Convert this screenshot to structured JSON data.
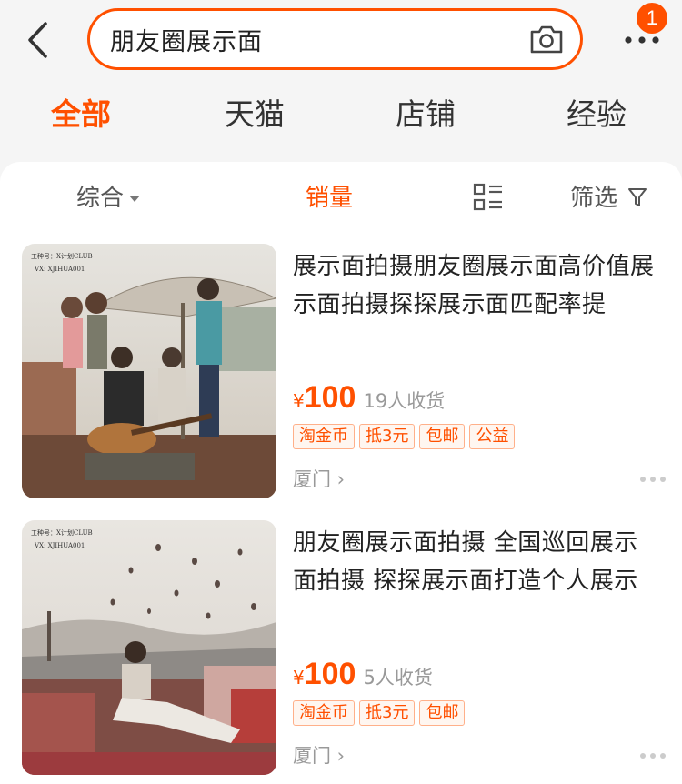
{
  "search": {
    "query": "朋友圈展示面"
  },
  "badge": {
    "count": "1"
  },
  "tabs": [
    {
      "label": "全部"
    },
    {
      "label": "天猫"
    },
    {
      "label": "店铺"
    },
    {
      "label": "经验"
    }
  ],
  "sort": {
    "comprehensive": "综合",
    "sales": "销量",
    "filter": "筛选"
  },
  "products": [
    {
      "title": "展示面拍摄朋友圈展示面高价值展示面拍摄探探展示面匹配率提",
      "yen": "¥",
      "price": "100",
      "sold": "19人收货",
      "tags": [
        "淘金币",
        "抵3元",
        "包邮",
        "公益"
      ],
      "location": "厦门",
      "image_caption_1": "工种号：X计划CLUB",
      "image_caption_2": "VX: XJIHUA001"
    },
    {
      "title": "朋友圈展示面拍摄 全国巡回展示面拍摄 探探展示面打造个人展示",
      "yen": "¥",
      "price": "100",
      "sold": "5人收货",
      "tags": [
        "淘金币",
        "抵3元",
        "包邮"
      ],
      "location": "厦门",
      "image_caption_1": "工种号：X计划CLUB",
      "image_caption_2": "VX: XJIHUA001"
    }
  ],
  "colors": {
    "accent": "#ff5000",
    "background": "#f5f5f5"
  }
}
